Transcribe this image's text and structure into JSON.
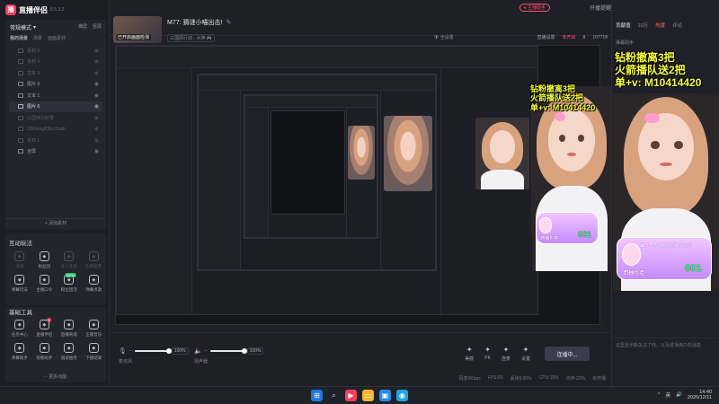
{
  "app": {
    "brand_name": "直播伴侣",
    "version": "8.5.3.2"
  },
  "sidebar": {
    "scene_mode": "常规模式",
    "scene_mode_arrow": "▾",
    "head_buttons": [
      "横屏",
      "竖屏"
    ],
    "tabs": [
      "我的场景",
      "场景",
      "画面素材"
    ],
    "sources": [
      {
        "label": "素材 5",
        "dim": true
      },
      {
        "label": "素材 4",
        "dim": true
      },
      {
        "label": "文本 3",
        "dim": true
      },
      {
        "label": "图片 9",
        "dim": false
      },
      {
        "label": "文本 1",
        "dim": false
      },
      {
        "label": "图片 6",
        "dim": false
      },
      {
        "label": "三国演义纪录",
        "dim": true
      },
      {
        "label": "10kdsag的fps1tuah",
        "dim": true
      },
      {
        "label": "素材 1",
        "dim": true
      },
      {
        "label": "全屏",
        "dim": false
      }
    ],
    "add_source": "+ 添加素材",
    "interact_title": "互动玩法",
    "interact_tools": [
      {
        "label": "连线",
        "icon": "mic-icon",
        "dim": true
      },
      {
        "label": "粉丝团",
        "icon": "shield-icon",
        "dim": false
      },
      {
        "label": "多人连麦",
        "icon": "multi-user-icon",
        "dim": true
      },
      {
        "label": "礼物投票",
        "icon": "star-icon",
        "dim": true
      },
      {
        "label": "弹幕玩法",
        "icon": "danmaku-icon",
        "dim": false
      },
      {
        "label": "主播口令",
        "icon": "command-icon",
        "dim": false
      },
      {
        "label": "粉丝团活",
        "icon": "heart-shield-icon",
        "dim": false,
        "badge": "NEW",
        "badge_color": "green"
      },
      {
        "label": "弹幕点歌",
        "icon": "music-icon",
        "dim": false
      }
    ],
    "basic_title": "基础工具",
    "basic_tools": [
      {
        "label": "任务中心",
        "icon": "task-icon",
        "dim": false
      },
      {
        "label": "直播伴侣",
        "icon": "ad-icon",
        "dim": false,
        "badge": "1"
      },
      {
        "label": "直播商城",
        "icon": "cart-icon",
        "dim": false
      },
      {
        "label": "正版音乐",
        "icon": "download-icon",
        "dim": false
      },
      {
        "label": "弹幕助手",
        "icon": "chat-bubble-icon",
        "dim": false
      },
      {
        "label": "观看助手",
        "icon": "eye-icon",
        "dim": false
      },
      {
        "label": "福袋抽奖",
        "icon": "gift-icon",
        "dim": false
      },
      {
        "label": "下播结束",
        "icon": "stop-icon",
        "dim": false
      }
    ],
    "more": "··· 更多功能"
  },
  "header": {
    "thumb_label": "已开启画面检测",
    "title": "M77: 猜谜小喵出击!",
    "sub_tag": "三国风行动 - 大神 🎮",
    "shield": "🛡 全设置",
    "right_items": [
      "直播设置",
      "未开启",
      "8",
      "107718"
    ],
    "window_status": "● 主播助手",
    "window_icons": [
      "开播提醒",
      "分享"
    ],
    "window_buttons": [
      "—",
      "▢",
      "✕"
    ]
  },
  "promo": {
    "line1": "钻粉撤离3把",
    "line2": "火箭播队送2把",
    "line3": "单+v: M10414420"
  },
  "sticker": {
    "top": "每日一秀: 西柚粉来撸公测",
    "num": "001",
    "name": "西柚也克"
  },
  "controls": {
    "mic_label": "麦克风",
    "mic_pct": "100%",
    "mic_level": 1.0,
    "spk_label": "扬声器",
    "spk_pct": "100%",
    "spk_level": 1.0,
    "tools": [
      {
        "label": "美颜",
        "icon": "beauty-icon"
      },
      {
        "label": "PK",
        "icon": "pk-icon"
      },
      {
        "label": "连麦",
        "icon": "link-icon"
      },
      {
        "label": "设置",
        "icon": "gear-icon"
      }
    ],
    "go_live": "连播中..."
  },
  "status_bar": [
    "码率0Kbps",
    "FPS:60",
    "丢帧0.00%",
    "CPU:15%",
    "内存:22%",
    "未开播"
  ],
  "chat": {
    "tabs": [
      "贡献值",
      "10万",
      "热度",
      "评论"
    ],
    "sub": "弹幕助手",
    "hint": "这里显示新关注了你，以及进场用户的消息"
  },
  "taskbar": {
    "time": "14:40",
    "date": "2025/12/11",
    "lang": "英",
    "tray": [
      "^",
      "🔊"
    ]
  },
  "colors": {
    "accent": "#ff3b5c",
    "promo_yellow": "#f7ff3c",
    "bg": "#1e1f27"
  }
}
